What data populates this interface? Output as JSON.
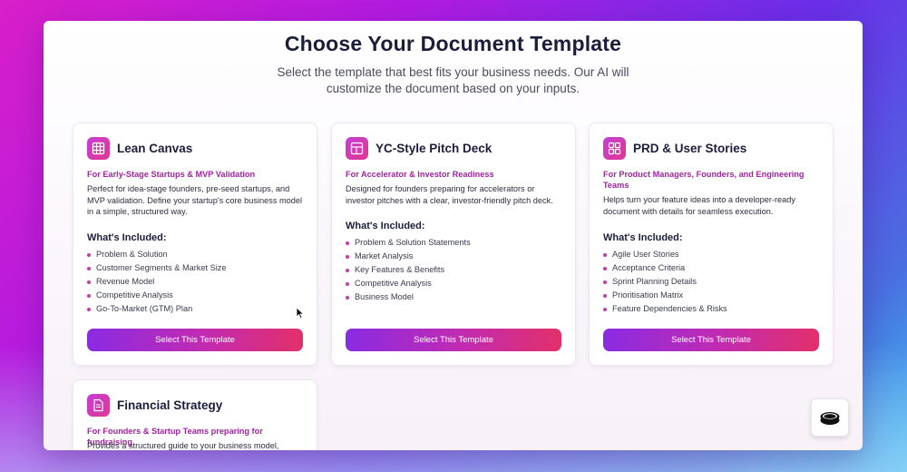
{
  "page": {
    "title": "Choose Your Document Template",
    "subtitle": "Select the template that best fits your business needs. Our AI will customize the document based on your inputs."
  },
  "cards": [
    {
      "icon": "grid-icon",
      "title": "Lean Canvas",
      "audience": "For Early-Stage Startups & MVP Validation",
      "description": "Perfect for idea-stage founders, pre-seed startups, and MVP validation. Define your startup's core business model in a simple, structured way.",
      "included_label": "What's Included:",
      "items": [
        "Problem & Solution",
        "Customer Segments & Market Size",
        "Revenue Model",
        "Competitive Analysis",
        "Go-To-Market (GTM) Plan"
      ],
      "button_label": "Select This Template"
    },
    {
      "icon": "layout-icon",
      "title": "YC-Style Pitch Deck",
      "audience": "For Accelerator & Investor Readiness",
      "description": "Designed for founders preparing for accelerators or investor pitches with a clear, investor-friendly pitch deck.",
      "included_label": "What's Included:",
      "items": [
        "Problem & Solution Statements",
        "Market Analysis",
        "Key Features & Benefits",
        "Competitive Analysis",
        "Business Model"
      ],
      "button_label": "Select This Template"
    },
    {
      "icon": "apps-icon",
      "title": "PRD & User Stories",
      "audience": "For Product Managers, Founders, and Engineering Teams",
      "description": "Helps turn your feature ideas into a developer-ready document with details for seamless execution.",
      "included_label": "What's Included:",
      "items": [
        "Agile User Stories",
        "Acceptance Criteria",
        "Sprint Planning Details",
        "Prioritisation Matrix",
        "Feature Dependencies & Risks"
      ],
      "button_label": "Select This Template"
    },
    {
      "icon": "document-icon",
      "title": "Financial Strategy",
      "audience": "For Founders & Startup Teams preparing for fundraising",
      "description": "Provides a structured guide to your business model,"
    }
  ],
  "colors": {
    "accent_purple": "#8a2be2",
    "accent_pink": "#e3306a",
    "audience_text": "#a0249f"
  }
}
